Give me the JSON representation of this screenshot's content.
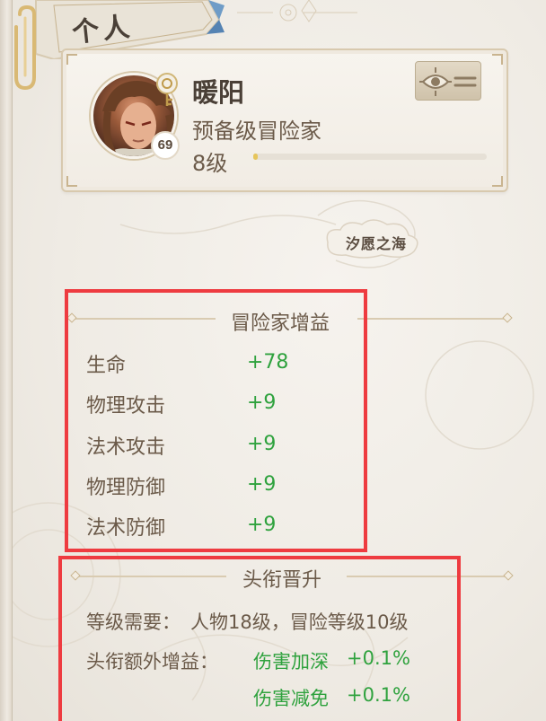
{
  "tab": {
    "title": "个人"
  },
  "profile": {
    "name": "暖阳",
    "rank_title": "预备级冒险家",
    "level_text": "8级",
    "avatar_level": "69",
    "xp_progress": 0.02
  },
  "location": {
    "label": "汐愿之海"
  },
  "adventurer_bonus": {
    "header": "冒险家增益",
    "stats": [
      {
        "label": "生命",
        "value": "+78"
      },
      {
        "label": "物理攻击",
        "value": "+9"
      },
      {
        "label": "法术攻击",
        "value": "+9"
      },
      {
        "label": "物理防御",
        "value": "+9"
      },
      {
        "label": "法术防御",
        "value": "+9"
      }
    ]
  },
  "title_promotion": {
    "header": "头衔晋升",
    "requirement_label": "等级需要：",
    "requirement_value": "人物18级，冒险等级10级",
    "extra_bonus_label": "头衔额外增益：",
    "bonuses": [
      {
        "name": "伤害加深",
        "value": "+0.1%"
      },
      {
        "name": "伤害减免",
        "value": "+0.1%"
      }
    ]
  },
  "colors": {
    "highlight": "#ee3b40",
    "bonus_green": "#2fa23e",
    "text_brown": "#6b5a49",
    "xp_gold": "#e6c55b"
  },
  "icons": [
    "paperclip-icon",
    "eye-emblem-icon",
    "rank-key-icon"
  ]
}
